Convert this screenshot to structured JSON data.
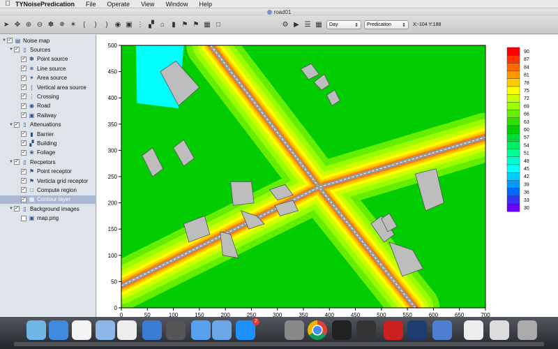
{
  "menubar": {
    "app": "TYNoisePredication",
    "items": [
      "File",
      "Operate",
      "View",
      "Window",
      "Help"
    ]
  },
  "window": {
    "title": "road01"
  },
  "toolbar": {
    "icons": [
      "arrow-icon",
      "move-icon",
      "zoom-in-icon",
      "zoom-out-icon",
      "point-source-icon",
      "line-source-icon",
      "area-source-icon",
      "wave-icon",
      "wave2-icon",
      "wave3-icon",
      "car-icon",
      "train-icon",
      "traffic-light-icon",
      "building-icon",
      "house-icon",
      "bar-icon",
      "flag-icon",
      "flag2-icon",
      "grid-icon",
      "region-icon"
    ],
    "period": "Day",
    "mode": "Predication",
    "coords": "X:-104 Y:188"
  },
  "tree": [
    {
      "label": "Noise map",
      "level": 0,
      "expanded": true,
      "checked": true,
      "icon": "layers-icon"
    },
    {
      "label": "Sources",
      "level": 1,
      "expanded": true,
      "checked": true,
      "icon": "folder-icon"
    },
    {
      "label": "Point source",
      "level": 2,
      "checked": true,
      "icon": "point-icon"
    },
    {
      "label": "Line source",
      "level": 2,
      "checked": true,
      "icon": "line-icon"
    },
    {
      "label": "Area source",
      "level": 2,
      "checked": true,
      "icon": "area-icon"
    },
    {
      "label": "Vertical area source",
      "level": 2,
      "checked": true,
      "icon": "vertical-icon"
    },
    {
      "label": "Crossing",
      "level": 2,
      "checked": true,
      "icon": "crossing-icon"
    },
    {
      "label": "Road",
      "level": 2,
      "checked": true,
      "icon": "car-icon"
    },
    {
      "label": "Railway",
      "level": 2,
      "checked": true,
      "icon": "train-icon"
    },
    {
      "label": "Attenuations",
      "level": 1,
      "expanded": true,
      "checked": true,
      "icon": "folder-icon"
    },
    {
      "label": "Barrier",
      "level": 2,
      "checked": true,
      "icon": "barrier-icon"
    },
    {
      "label": "Building",
      "level": 2,
      "checked": true,
      "icon": "building-icon"
    },
    {
      "label": "Foliage",
      "level": 2,
      "checked": true,
      "icon": "foliage-icon"
    },
    {
      "label": "Recpetors",
      "level": 1,
      "expanded": true,
      "checked": true,
      "icon": "folder-icon"
    },
    {
      "label": "Point receptor",
      "level": 2,
      "checked": true,
      "icon": "flag-icon"
    },
    {
      "label": "Verticla grid receptor",
      "level": 2,
      "checked": true,
      "icon": "flag2-icon"
    },
    {
      "label": "Compute region",
      "level": 2,
      "checked": true,
      "icon": "region-icon"
    },
    {
      "label": "Contour layer",
      "level": 2,
      "checked": true,
      "icon": "contour-icon",
      "selected": true
    },
    {
      "label": "Background images",
      "level": 1,
      "expanded": true,
      "checked": true,
      "icon": "folder-icon"
    },
    {
      "label": "map.png",
      "level": 2,
      "checked": false,
      "icon": "image-icon"
    }
  ],
  "map": {
    "x_ticks": [
      "0",
      "50",
      "100",
      "150",
      "200",
      "250",
      "300",
      "350",
      "400",
      "450",
      "500",
      "550",
      "600",
      "650",
      "700"
    ],
    "y_ticks": [
      "500",
      "450",
      "400",
      "350",
      "300",
      "250",
      "200",
      "150",
      "100",
      "50",
      "0"
    ],
    "xlim": [
      0,
      700
    ],
    "ylim": [
      0,
      500
    ]
  },
  "legend": {
    "levels": [
      "90",
      "87",
      "84",
      "81",
      "78",
      "75",
      "72",
      "69",
      "66",
      "63",
      "60",
      "57",
      "54",
      "51",
      "48",
      "45",
      "42",
      "39",
      "36",
      "33",
      "30"
    ],
    "colors": [
      "#ff0000",
      "#ff3300",
      "#ff6600",
      "#ff9900",
      "#ffcc00",
      "#ffff00",
      "#ccff00",
      "#99ff00",
      "#66ee00",
      "#33dd00",
      "#00cc00",
      "#00dd33",
      "#00ee66",
      "#00ff99",
      "#00ffcc",
      "#00ffff",
      "#00ccff",
      "#0099ff",
      "#0066ff",
      "#3333ff",
      "#6600ff"
    ]
  },
  "colors": {
    "band_low": "#00cc00",
    "band_mid": "#ccff00",
    "band_high": "#ffcc00",
    "band_peak": "#ff0000",
    "cyan": "#00ffff",
    "building": "#bdbdbd"
  },
  "dock": {
    "badge": "2"
  }
}
